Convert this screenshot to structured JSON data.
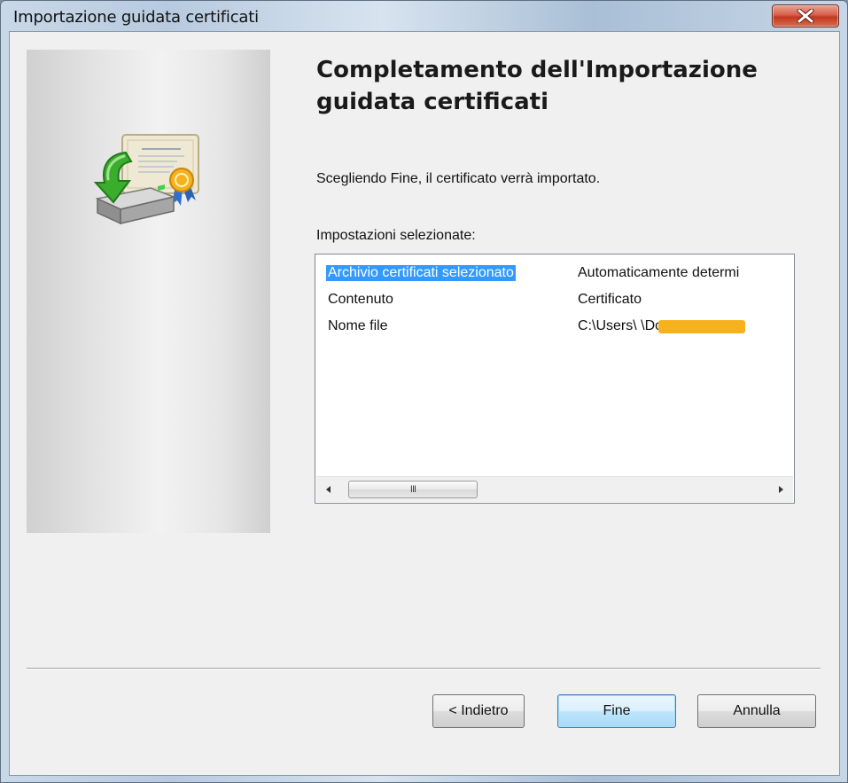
{
  "window": {
    "title": "Importazione guidata certificati"
  },
  "wizard": {
    "heading": "Completamento dell'Importazione guidata certificati",
    "intro": "Scegliendo Fine, il certificato verrà importato.",
    "settings_label": "Impostazioni selezionate:",
    "settings": [
      {
        "name": "Archivio certificati selezionato",
        "value": "Automaticamente determi",
        "selected": true
      },
      {
        "name": "Contenuto",
        "value": "Certificato",
        "selected": false
      },
      {
        "name": "Nome file",
        "value": "C:\\Users\\                 \\Docu",
        "selected": false
      }
    ],
    "scroll_thumb_grip": "III"
  },
  "buttons": {
    "back": "< Indietro",
    "finish": "Fine",
    "cancel": "Annulla"
  },
  "icons": {
    "close": "close-icon",
    "wizard": "certificate-import-icon",
    "scroll_left": "scroll-left-arrow-icon",
    "scroll_right": "scroll-right-arrow-icon"
  },
  "colors": {
    "selection": "#3399ff",
    "redaction": "#f5b21c",
    "close_button": "#c3391f"
  }
}
